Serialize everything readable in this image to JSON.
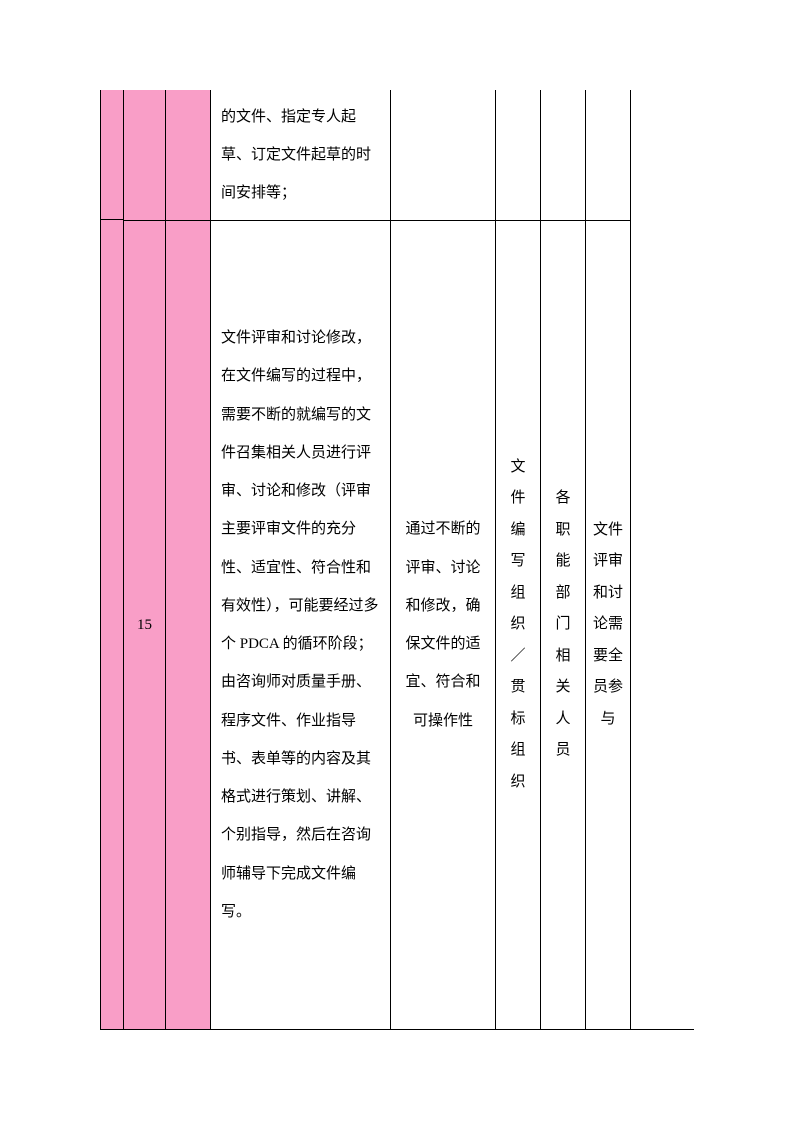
{
  "table": {
    "row_number": "15",
    "col3_top": "",
    "col3_bottom": "",
    "col4_top": "的文件、指定专人起草、订定文件起草的时间安排等；",
    "col4_bottom": "文件评审和讨论修改，在文件编写的过程中，需要不断的就编写的文件召集相关人员进行评审、讨论和修改（评审主要评审文件的充分性、适宜性、符合性和有效性），可能要经过多个 PDCA 的循环阶段；由咨询师对质量手册、程序文件、作业指导书、表单等的内容及其格式进行策划、讲解、个别指导，然后在咨询师辅导下完成文件编写。",
    "col5_top": "",
    "col5_bottom": "通过不断的评审、讨论和修改，确保文件的适宜、符合和可操作性",
    "col6_top": "",
    "col6_bottom_chars": [
      "文",
      "件",
      "编",
      "写",
      "组",
      "织",
      "／",
      "贯",
      "标",
      "组",
      "织"
    ],
    "col7_top": "",
    "col7_bottom_chars": [
      "各",
      "职",
      "能",
      "部",
      "门",
      "相",
      "关",
      "人",
      "员"
    ],
    "col8_top": "",
    "col8_bottom_chars": [
      "文件",
      "评审",
      "和讨",
      "论需",
      "要全",
      "员参",
      "与"
    ]
  }
}
